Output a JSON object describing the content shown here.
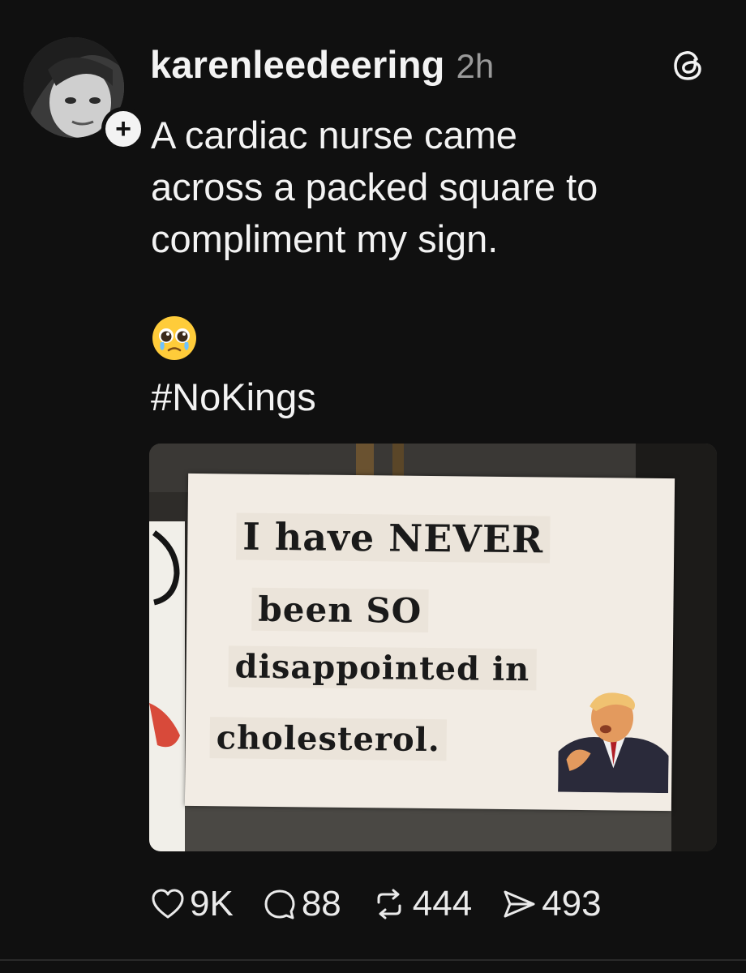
{
  "post": {
    "username": "karenleedeering",
    "time": "2h",
    "text": "A cardiac nurse came\nacross a packed square to\ncompliment my sign.",
    "emoji": "pleading-face-with-tears",
    "hashtag": "#NoKings"
  },
  "media": {
    "sign_lines": [
      "I have NEVER",
      "been SO",
      "disappointed in",
      "cholesterol."
    ]
  },
  "actions": {
    "likes": "9K",
    "replies": "88",
    "reposts": "444",
    "shares": "493"
  },
  "icons": {
    "logo": "threads-logo-icon",
    "follow": "plus-icon",
    "like": "heart-icon",
    "reply": "comment-bubble-icon",
    "repost": "repost-icon",
    "share": "send-icon"
  },
  "colors": {
    "background": "#101010",
    "text": "#f3f3f3",
    "muted": "#9a9a9a"
  }
}
